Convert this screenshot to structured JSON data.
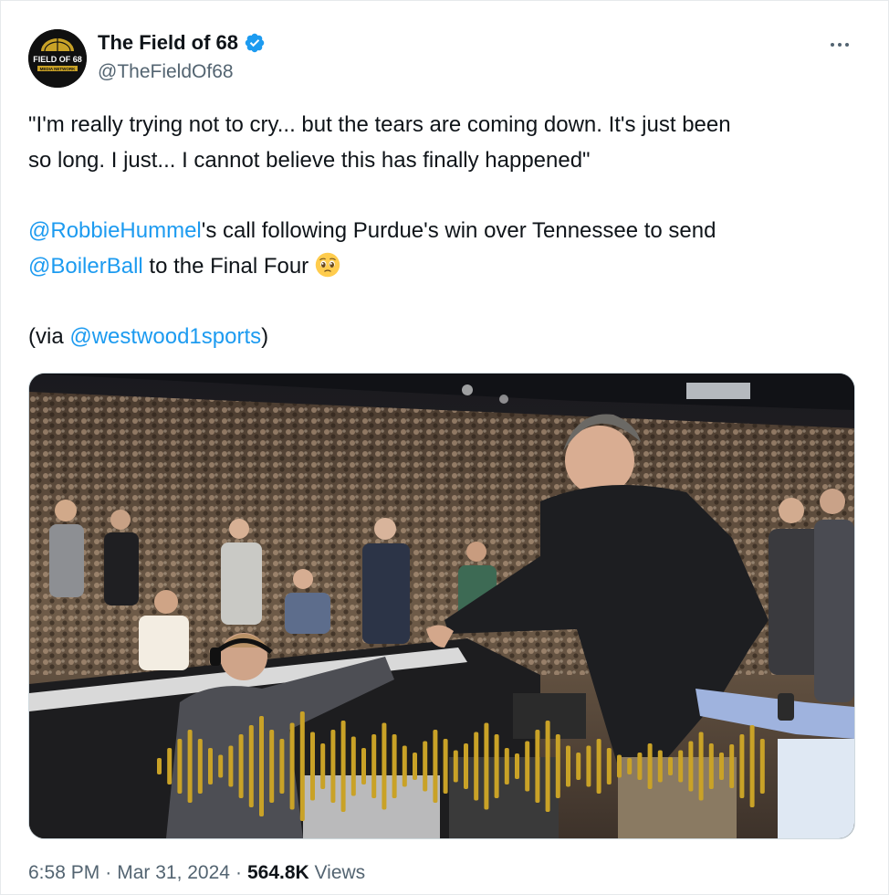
{
  "author": {
    "display_name": "The Field of 68",
    "handle": "@TheFieldOf68",
    "avatar_text": "FIELD OF 68",
    "avatar_subtext": "MEDIA NETWORK",
    "verified_icon": "verified-badge-icon"
  },
  "menu": {
    "icon": "more-options-icon"
  },
  "tweet": {
    "quote_line1": "\"I'm really trying not to cry... but the tears are coming down. It's just been",
    "quote_line2": "so long. I just... I cannot believe this has finally happened\"",
    "mention1": "@RobbieHummel",
    "text_after_mention1": "'s call following Purdue's win over Tennessee to send",
    "mention2": "@BoilerBall",
    "text_after_mention2": " to the Final Four ",
    "emoji": "pleading-face-emoji",
    "via_prefix": "(via ",
    "mention3": "@westwood1sports",
    "via_suffix": ")"
  },
  "media": {
    "description_icon": "audio-waveform-icon",
    "accent_color": "#c9a227"
  },
  "footer": {
    "time": "6:58 PM",
    "separator": "·",
    "date": "Mar 31, 2024",
    "views_count": "564.8K",
    "views_label": "Views"
  },
  "colors": {
    "link": "#1d9bf0",
    "secondary_text": "#536471",
    "verified": "#1d9bf0"
  }
}
